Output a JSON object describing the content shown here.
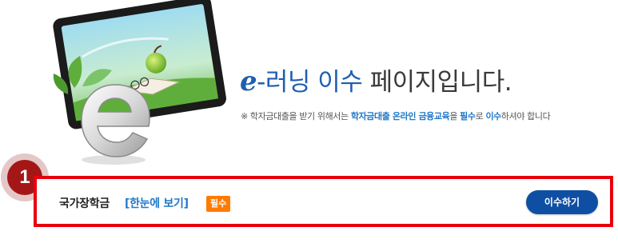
{
  "colors": {
    "accent_blue": "#1f5fb0",
    "link_blue": "#1f78c8",
    "button_blue": "#0f4fa3",
    "highlight_red": "#e8000b",
    "badge_orange": "#ff7a00",
    "marker_red": "#a51717"
  },
  "hero": {
    "illustration_icon": "tablet-with-e-logo",
    "headline_e": "e",
    "headline_part1": "-러닝 이수",
    "headline_part2": " 페이지입니다."
  },
  "notice": {
    "prefix": "※ 학자금대출을 받기 위해서는 ",
    "hl1": "학자금대출 온라인 금융교육",
    "mid1": "을 ",
    "hl2": "필수",
    "mid2": "로 ",
    "hl3": "이수",
    "suffix": "하셔야 합니다"
  },
  "step": {
    "number": "1"
  },
  "course": {
    "title": "국가장학금",
    "link_label": "[한눈에 보기]",
    "badge": "필수",
    "button_label": "이수하기"
  }
}
